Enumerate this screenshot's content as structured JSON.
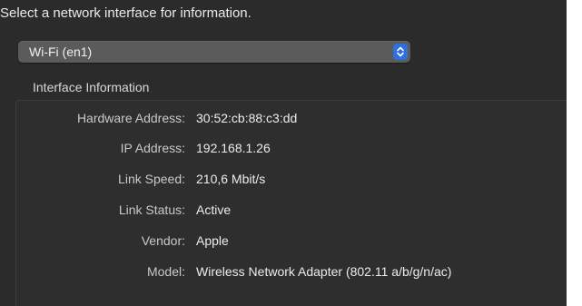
{
  "prompt": "Select a network interface for information.",
  "interface_popup": {
    "selected": "Wi-Fi (en1)",
    "stepper_icon": "chevron-up-down-icon",
    "accent_color": "#2f6fe0"
  },
  "section_title": "Interface Information",
  "info": [
    {
      "label": "Hardware Address:",
      "value": "30:52:cb:88:c3:dd"
    },
    {
      "label": "IP Address:",
      "value": "192.168.1.26"
    },
    {
      "label": "Link Speed:",
      "value": "210,6 Mbit/s"
    },
    {
      "label": "Link Status:",
      "value": "Active"
    },
    {
      "label": "Vendor:",
      "value": "Apple"
    },
    {
      "label": "Model:",
      "value": "Wireless Network Adapter (802.11 a/b/g/n/ac)"
    }
  ]
}
